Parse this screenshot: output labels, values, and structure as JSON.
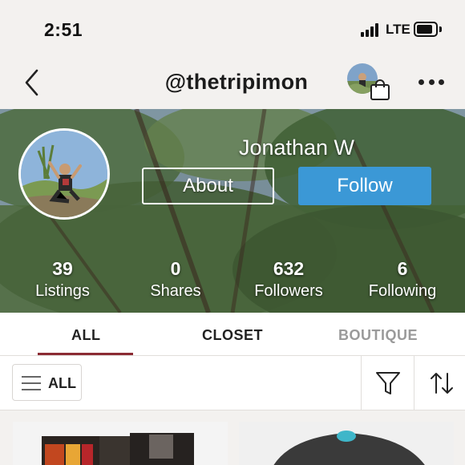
{
  "status_bar": {
    "time": "2:51",
    "network": "LTE"
  },
  "nav": {
    "title": "@thetripimon",
    "back_icon": "chevron-left-icon",
    "bag_icon": "shopping-bag-icon",
    "more_icon": "more-horizontal-icon"
  },
  "profile": {
    "name": "Jonathan W",
    "about_label": "About",
    "follow_label": "Follow",
    "stats": [
      {
        "value": "39",
        "label": "Listings"
      },
      {
        "value": "0",
        "label": "Shares"
      },
      {
        "value": "632",
        "label": "Followers"
      },
      {
        "value": "6",
        "label": "Following"
      }
    ]
  },
  "tabs": [
    {
      "label": "ALL",
      "active": true
    },
    {
      "label": "CLOSET",
      "active": false
    },
    {
      "label": "BOUTIQUE",
      "active": false
    }
  ],
  "filter_bar": {
    "all_label": "ALL",
    "filter_icon": "funnel-icon",
    "sort_icon": "sort-arrows-icon"
  },
  "colors": {
    "accent_blue": "#3b98d6",
    "tab_underline": "#8b2b33",
    "header_bg": "#f3f1ef",
    "inactive_tab": "#9a9a9a"
  }
}
